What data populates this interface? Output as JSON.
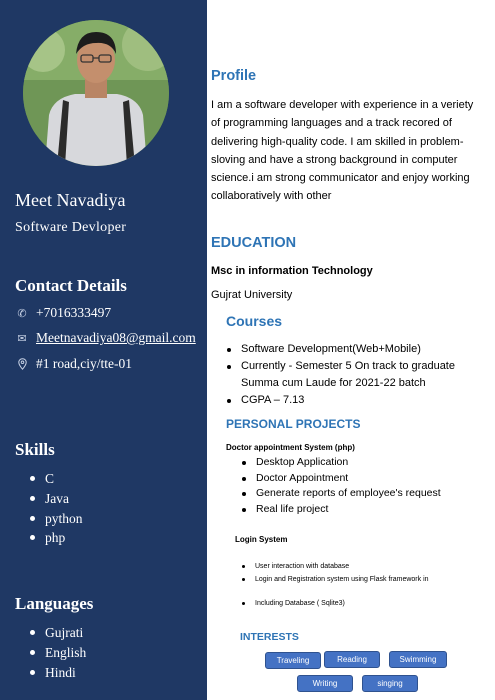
{
  "sidebar": {
    "name": "Meet Navadiya",
    "role": "Software  Devloper",
    "contact_heading": "Contact Details",
    "phone": "+7016333497",
    "email": "Meetnavadiya08@gmail.com",
    "address": "#1 road,ciy/tte-01",
    "skills_heading": "Skills",
    "skills": [
      "C",
      "Java",
      "python",
      "php"
    ],
    "languages_heading": "Languages",
    "languages": [
      "Gujrati",
      "English",
      "Hindi"
    ]
  },
  "main": {
    "profile_heading": "Profile",
    "profile_text": "I am a software developer with experience in a veriety of programming languages and a track recored of delivering high-quality code. I am skilled in problem-sloving and have a strong background in computer science.i am strong communicator and enjoy working collaboratively  with other",
    "education_heading": "EDUCATION",
    "degree": "Msc in information Technology",
    "university": "Gujrat University",
    "courses_heading": "Courses",
    "courses": [
      "Software Development(Web+Mobile)",
      "Currently - Semester 5 On track to graduate Summa cum Laude for 2021-22 batch",
      "CGPA – 7.13"
    ],
    "projects_heading": "PERSONAL PROJECTS",
    "project1_title": "Doctor appointment System (php)",
    "project1_items": [
      "Desktop Application",
      "Doctor Appointment",
      "Generate reports of employee's request",
      "Real life project"
    ],
    "project2_title": "Login System",
    "project2_items": [
      "User interaction with database",
      "Login and Registration system using Flask framework in"
    ],
    "project2_extra": "Including Database ( Sqlite3)",
    "interests_heading": "INTERESTS",
    "interests": [
      "Traveling",
      "Reading",
      "Swimming",
      "Writing",
      "singing"
    ]
  }
}
